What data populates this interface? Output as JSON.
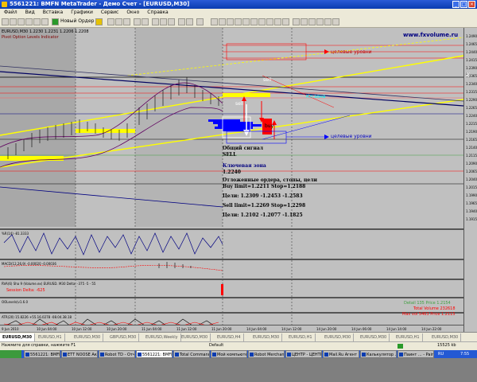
{
  "window": {
    "title": "5561221: BMFN MetaTrader - Демо Счет - [EURUSD,M30]"
  },
  "menu": {
    "items": [
      "Файл",
      "Вид",
      "Вставка",
      "Графики",
      "Сервис",
      "Окно",
      "Справка"
    ]
  },
  "toolbar": {
    "new_order_label": "Новый Ордер"
  },
  "chart": {
    "symbol_info": "EURUSD,M30 1.2230 1.2231 1.2206 1.2208",
    "indicator_name": "Pivot Option Levels Indicator",
    "watermark": "www.fxvolume.ru",
    "annotations": {
      "target_levels_top": "целевые уровни",
      "target_levels_bottom": "целевые уровни",
      "sell_top": "sell",
      "sell_left": "sell",
      "buy": "buy",
      "key_zone_label": "Кл.зона"
    },
    "signal": {
      "title": "Общий сигнал",
      "value": "SELL",
      "key_zone_title": "Ключевая зона",
      "key_zone_value": "1.2240",
      "pending_title": "Отложенные ордера, стопы, цели",
      "buy_limit": "Buy limit=1.2211 Stop=1.2188",
      "targets_1": "Цели: 1.2309 -1.2453 -1.2583",
      "sell_limit": "Sell limit=1.2269 Stop=1.2298",
      "targets_2": "Цели: 1.2102 -1.2077 -1.1825"
    },
    "prices": [
      "1.2490",
      "1.2465",
      "1.2440",
      "1.2415",
      "1.2390",
      "1.2365",
      "1.2340",
      "1.2315",
      "1.2290",
      "1.2265",
      "1.2240",
      "1.2215",
      "1.2190",
      "1.2165",
      "1.2140",
      "1.2115",
      "1.2090",
      "1.2065",
      "1.2040",
      "1.2015",
      "1.1990",
      "1.1965",
      "1.1940",
      "1.1915"
    ],
    "price_r1": "R1",
    "times": [
      "9 Jun 2010",
      "10 Jun 04:00",
      "10 Jun 12:00",
      "10 Jun 20:00",
      "11 Jun 04:00",
      "11 Jun 12:00",
      "11 Jun 20:00",
      "14 Jun 04:00",
      "14 Jun 12:00",
      "14 Jun 20:00",
      "14 Jun 06:00",
      "14 Jun 14:00",
      "14 Jun 22:00"
    ]
  },
  "panels": {
    "wpr_label": "%R(14) -81.3333",
    "macd_label": "MACD(12,26,9) -0.00020 -0.00036",
    "rva_label": "RVA(6) Sha 9 (Volume.ex) EURUSD. M30 Delta: -375 -5 - 55",
    "session_delta": "Session Delta: -625",
    "oscillator_label": "OOLevels(v1.6.0",
    "stoch_label": "ATR(20) 15.8226 +55.16.0278 -08.04.38.18",
    "volume_info": {
      "detail": "Detail 135 Price 1.2154",
      "total": "Total Volume 232618",
      "max": "Max vol 5463 Price 1.2115"
    }
  },
  "tabs": [
    "EURUSD,M30",
    "EURUSD,H1",
    "EURUSD,M30",
    "GBPUSD,M30",
    "EURUSD,Weekly",
    "EURUSD,M30",
    "EURUSD,H4",
    "EURUSD,M30",
    "EURUSD,H1",
    "EURUSD,M30",
    "EURUSD,M30",
    "EURUSD,H1",
    "EURUSD,M30"
  ],
  "status": {
    "help": "Нажмите для справки, нажмите F1",
    "profile": "Default",
    "connection": "15525 kb"
  },
  "taskbar": {
    "items": [
      "5561221: BMFN M...",
      "ЕТТ NOOSE Активатор...",
      "Robot TD - Отчет...",
      "5561221: BMFN MT...",
      "Total Commander...",
      "Мой компьютер...",
      "Robot Merchant ...",
      "ЦЕНТР - ЦЕНТР ...",
      "Mail.Ru Агент (1 ...",
      "Калькулятор ...",
      "Паинт ... - Paint ..."
    ],
    "lang": "RU",
    "clock": "7:55"
  },
  "colors": {
    "chart_bg": "#c0c0c0",
    "accent_yellow": "#ffff00",
    "accent_red": "#ff0000",
    "accent_blue": "#0000ff",
    "accent_navy": "#000080"
  }
}
